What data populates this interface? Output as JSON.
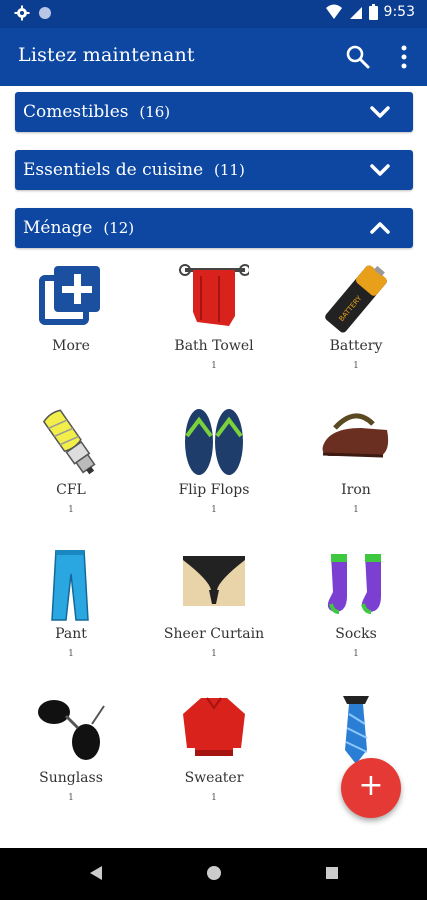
{
  "status_bar": {
    "time": "9:53",
    "icons": [
      "gear-icon",
      "circle-icon",
      "wifi-icon",
      "signal-icon",
      "battery-icon"
    ]
  },
  "app_bar": {
    "title": "Listez maintenant",
    "icons": [
      "search-icon",
      "more-vert-icon"
    ]
  },
  "sections": [
    {
      "name": "Comestibles",
      "count": "(16)",
      "icon": "chevron-down-icon"
    },
    {
      "name": "Essentiels de cuisine",
      "count": "(11)",
      "icon": "chevron-down-icon"
    },
    {
      "name": "Ménage",
      "count": "(12)",
      "icon": "chevron-up-icon"
    }
  ],
  "items": [
    {
      "name": "More",
      "qty": "",
      "icon": "add-box-icon"
    },
    {
      "name": "Bath Towel",
      "qty": "1",
      "icon": "towel-icon"
    },
    {
      "name": "Battery",
      "qty": "1",
      "icon": "battery-cell-icon"
    },
    {
      "name": "CFL",
      "qty": "1",
      "icon": "cfl-bulb-icon"
    },
    {
      "name": "Flip Flops",
      "qty": "1",
      "icon": "flip-flops-icon"
    },
    {
      "name": "Iron",
      "qty": "1",
      "icon": "iron-icon"
    },
    {
      "name": "Pant",
      "qty": "1",
      "icon": "pant-icon"
    },
    {
      "name": "Sheer Curtain",
      "qty": "1",
      "icon": "curtain-icon"
    },
    {
      "name": "Socks",
      "qty": "1",
      "icon": "socks-icon"
    },
    {
      "name": "Sunglass",
      "qty": "1",
      "icon": "sunglasses-icon"
    },
    {
      "name": "Sweater",
      "qty": "1",
      "icon": "sweater-icon"
    },
    {
      "name": "",
      "qty": "",
      "icon": "tie-icon"
    }
  ],
  "fab": {
    "label": "+",
    "icon": "add-icon"
  },
  "colors": {
    "primary": "#0d47a1",
    "status_bar": "#0b3e91",
    "fab": "#e53935"
  }
}
